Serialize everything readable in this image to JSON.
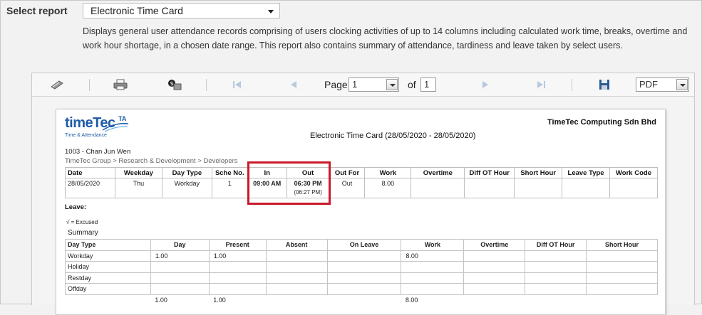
{
  "header": {
    "select_label": "Select report",
    "report_selected": "Electronic Time Card",
    "description": "Displays general user attendance records comprising of users clocking activities of up to 14 columns including calculated work time, breaks, overtime and work hour shortage, in a chosen date range. This report also contains summary of attendance, tardiness and leave taken by select users."
  },
  "toolbar": {
    "page_label": "Page",
    "page_value": "1",
    "of_label": "of",
    "total_pages": "1",
    "format_value": "PDF",
    "icons": [
      "refresh-icon",
      "print-icon",
      "export-icon",
      "first-page-icon",
      "prev-page-icon",
      "next-page-icon",
      "last-page-icon",
      "save-icon"
    ]
  },
  "report": {
    "logo_main": "timeTec",
    "logo_ta": "TA",
    "logo_sub": "Time & Attendance",
    "company": "TimeTec Computing Sdn Bhd",
    "title": "Electronic Time Card  (28/05/2020 - 28/05/2020)",
    "user_name": "1003 - Chan Jun Wen",
    "user_path": "TimeTec Group > Research & Development > Developers",
    "columns": [
      "Date",
      "Weekday",
      "Day Type",
      "Sche No.",
      "In",
      "Out",
      "Out For",
      "Work",
      "Overtime",
      "Diff OT Hour",
      "Short Hour",
      "Leave Type",
      "Work Code"
    ],
    "row": {
      "date": "28/05/2020",
      "weekday": "Thu",
      "day_type": "Workday",
      "sche_no": "1",
      "in": "09:00 AM",
      "out": "06:30 PM",
      "out_actual": "(06:27 PM)",
      "out_for": "Out",
      "work": "8.00",
      "overtime": "",
      "diff_ot": "",
      "short_hour": "",
      "leave_type": "",
      "work_code": ""
    },
    "leave_label": "Leave:",
    "excused_note": "√  = Excused",
    "summary_label": "Summary",
    "summary_columns": [
      "Day Type",
      "Day",
      "Present",
      "Absent",
      "On Leave",
      "Work",
      "Overtime",
      "Diff OT Hour",
      "Short Hour"
    ],
    "summary_rows": [
      {
        "day_type": "Workday",
        "day": "1.00",
        "present": "1.00",
        "absent": "",
        "on_leave": "",
        "work": "8.00",
        "overtime": "",
        "diff_ot": "",
        "short": ""
      },
      {
        "day_type": "Holiday",
        "day": "",
        "present": "",
        "absent": "",
        "on_leave": "",
        "work": "",
        "overtime": "",
        "diff_ot": "",
        "short": ""
      },
      {
        "day_type": "Restday",
        "day": "",
        "present": "",
        "absent": "",
        "on_leave": "",
        "work": "",
        "overtime": "",
        "diff_ot": "",
        "short": ""
      },
      {
        "day_type": "Offday",
        "day": "",
        "present": "",
        "absent": "",
        "on_leave": "",
        "work": "",
        "overtime": "",
        "diff_ot": "",
        "short": ""
      }
    ],
    "summary_total": {
      "day": "1.00",
      "present": "1.00",
      "work": "8.00"
    }
  }
}
